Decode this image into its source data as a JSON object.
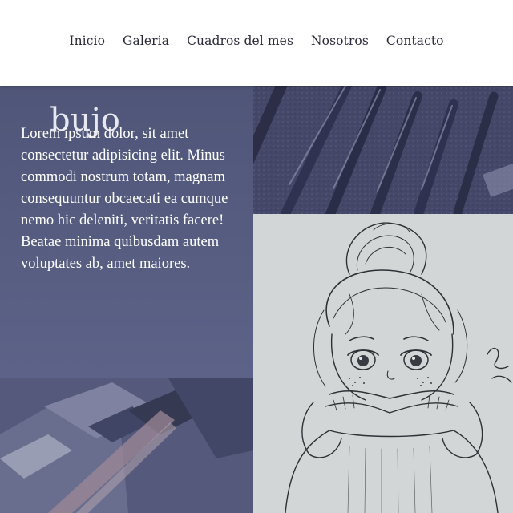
{
  "nav": {
    "items": [
      "Inicio",
      "Galeria",
      "Cuadros del mes",
      "Nosotros",
      "Contacto"
    ]
  },
  "section": {
    "title_fragment": "bujo",
    "paragraph": "Lorem ipsum dolor, sit amet consectetur adipisicing elit. Minus commodi nostrum totam, magnam consequuntur obcaecati ea cumque nemo hic deleniti, veritatis facere! Beatae minima quibusdam autem voluptates ab, amet maiores."
  },
  "images": {
    "brushes": "paint-brushes-photo",
    "sketch": "girl-pencil-sketch",
    "palette": "watercolor-palette-photo"
  },
  "colors": {
    "panel": "#515779",
    "overlay": "#4b5175",
    "nav_text": "#2a2a3a"
  }
}
